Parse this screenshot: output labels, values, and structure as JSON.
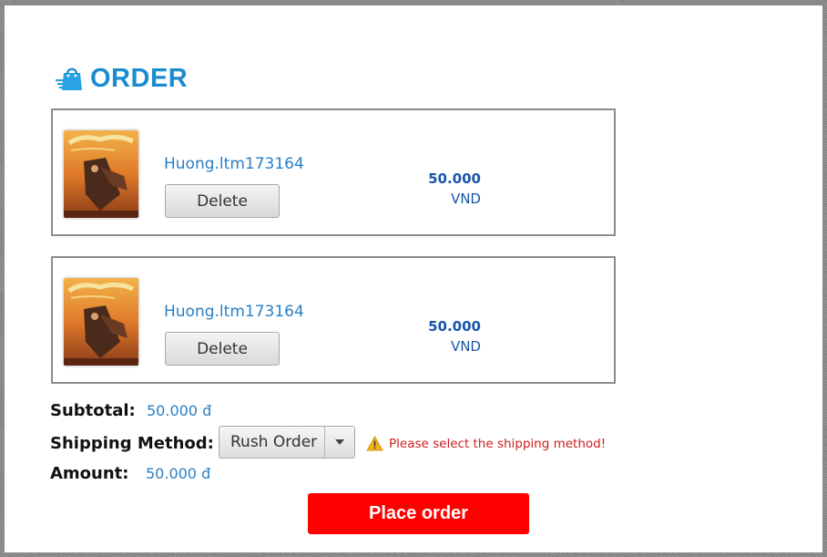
{
  "header": {
    "title": "ORDER",
    "icon": "shopping-bag-icon",
    "accent": "#1a8ccf"
  },
  "items": [
    {
      "name": "Huong.ltm173164",
      "delete_label": "Delete",
      "price": "50.000",
      "currency": "VND",
      "cover": "book-cover-image"
    },
    {
      "name": "Huong.ltm173164",
      "delete_label": "Delete",
      "price": "50.000",
      "currency": "VND",
      "cover": "book-cover-image"
    }
  ],
  "summary": {
    "subtotal_label": "Subtotal:",
    "subtotal_value": "50.000 đ",
    "shipping_label": "Shipping Method:",
    "shipping_selected": "Rush Order",
    "shipping_warning": "Please select the shipping method!",
    "amount_label": "Amount:",
    "amount_value": "50.000 đ"
  },
  "actions": {
    "place_order_label": "Place order",
    "place_order_color": "#ff0000"
  }
}
